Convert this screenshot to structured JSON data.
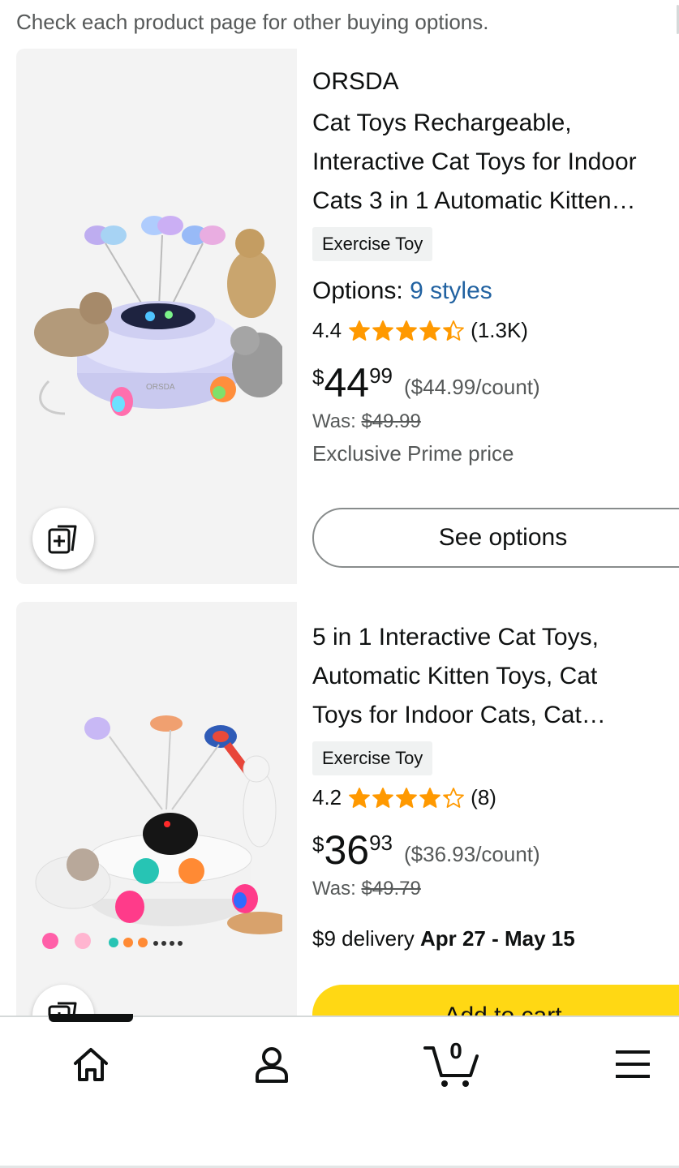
{
  "notice": "Check each product page for other buying options.",
  "colors": {
    "star": "#ff9900",
    "link": "#2162a1",
    "add_to_cart": "#ffd814"
  },
  "products": [
    {
      "brand": "ORSDA",
      "title_lines": [
        "Cat Toys Rechargeable,",
        "Interactive Cat Toys for Indoor",
        "Cats 3 in 1 Automatic Kitten…"
      ],
      "badge": "Exercise Toy",
      "options_label": "Options:",
      "options_link": "9 styles",
      "rating": "4.4",
      "rating_value": 4.4,
      "reviews": "(1.3K)",
      "price_symbol": "$",
      "price_whole": "44",
      "price_fraction": "99",
      "unit_price": "($44.99/count)",
      "was_label": "Was:",
      "was_price": "$49.99",
      "prime_note": "Exclusive Prime price",
      "action_label": "See options",
      "image_label": "ORSDA"
    },
    {
      "title_lines": [
        "5 in 1 Interactive Cat Toys,",
        "Automatic Kitten Toys, Cat",
        "Toys for Indoor Cats, Cat…"
      ],
      "badge": "Exercise Toy",
      "rating": "4.2",
      "rating_value": 4.2,
      "reviews": "(8)",
      "price_symbol": "$",
      "price_whole": "36",
      "price_fraction": "93",
      "unit_price": "($36.93/count)",
      "was_label": "Was:",
      "was_price": "$49.79",
      "delivery_prefix": "$9 delivery",
      "delivery_dates": "Apr 27 - May 15",
      "action_label": "Add to cart"
    }
  ],
  "nav": {
    "cart_count": "0",
    "items": [
      "home-icon",
      "account-icon",
      "cart-icon",
      "menu-icon"
    ]
  }
}
